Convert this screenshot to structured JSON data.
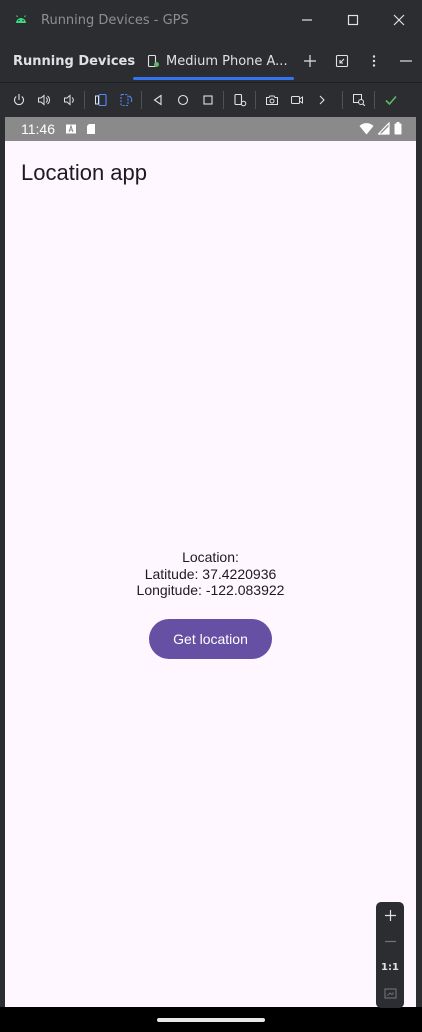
{
  "window": {
    "title": "Running Devices - GPS"
  },
  "tool_window": {
    "title": "Running Devices",
    "tab_label": "Medium Phone A..."
  },
  "status_bar": {
    "time": "11:46"
  },
  "app": {
    "title": "Location app",
    "location_label": "Location:",
    "latitude_text": "Latitude: 37.4220936",
    "longitude_text": "Longitude: -122.083922",
    "button_label": "Get location"
  },
  "zoom": {
    "actual_size_label": "1:1"
  },
  "colors": {
    "ide_background": "#2b2d30",
    "accent": "#3574f0",
    "app_background": "#fef7ff",
    "button": "#6650a4",
    "success": "#5fb865",
    "android_green": "#3ddc84"
  }
}
